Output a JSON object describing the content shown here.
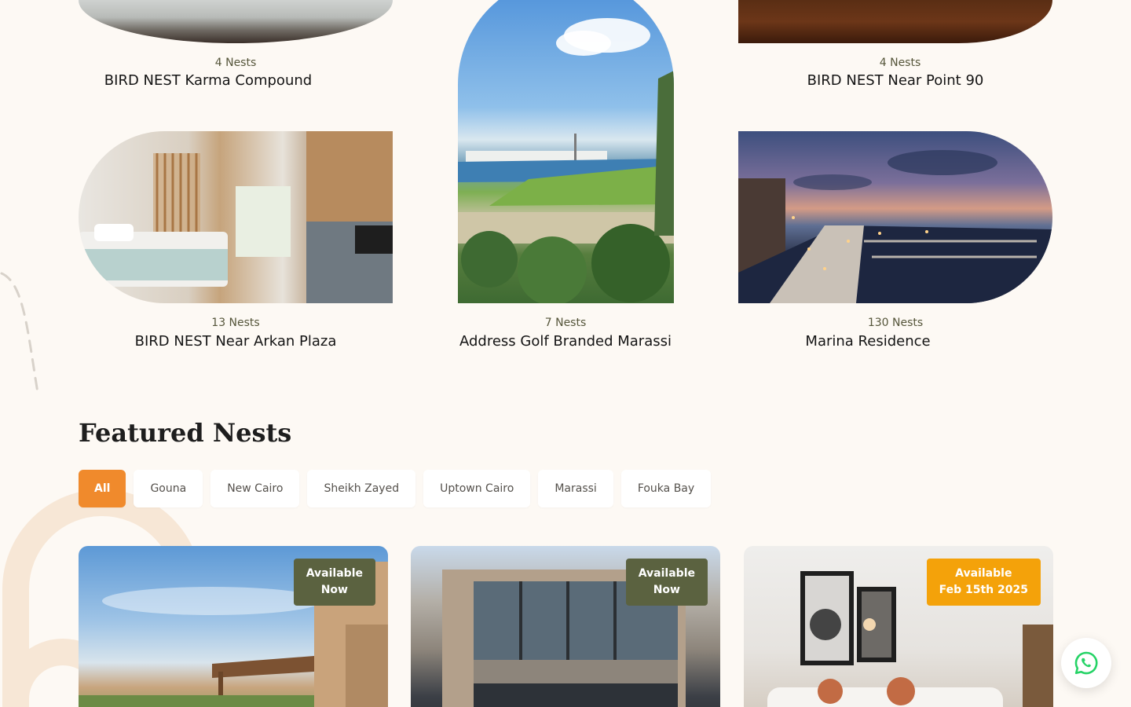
{
  "developments": [
    {
      "count": "4 Nests",
      "name": "BIRD NEST Karma Compound",
      "icon": "sofa-photo"
    },
    {
      "count": "4 Nests",
      "name": "BIRD NEST Near Point 90",
      "icon": "chairs-photo"
    },
    {
      "count": "13 Nests",
      "name": "BIRD NEST Near Arkan Plaza",
      "icon": "bedroom-photo"
    },
    {
      "count": "7 Nests",
      "name": "Address Golf Branded Marassi",
      "icon": "golf-photo"
    },
    {
      "count": "130 Nests",
      "name": "Marina Residence",
      "icon": "marina-photo"
    }
  ],
  "featured": {
    "title": "Featured Nests",
    "filters": [
      "All",
      "Gouna",
      "New Cairo",
      "Sheikh Zayed",
      "Uptown Cairo",
      "Marassi",
      "Fouka Bay"
    ],
    "active_filter": "All",
    "cards": [
      {
        "badge_line1": "Available",
        "badge_line2": "Now",
        "badge_color": "#5b6240"
      },
      {
        "badge_line1": "Available",
        "badge_line2": "Now",
        "badge_color": "#5b6240"
      },
      {
        "badge_line1": "Available",
        "badge_line2": "Feb 15th 2025",
        "badge_color": "#f4a20a"
      }
    ]
  },
  "colors": {
    "accent": "#f08a2c",
    "background": "#fdf9f4",
    "olive": "#5b6240",
    "amber": "#f4a20a",
    "whatsapp": "#25d366"
  },
  "icons": {
    "whatsapp": "whatsapp-icon"
  }
}
